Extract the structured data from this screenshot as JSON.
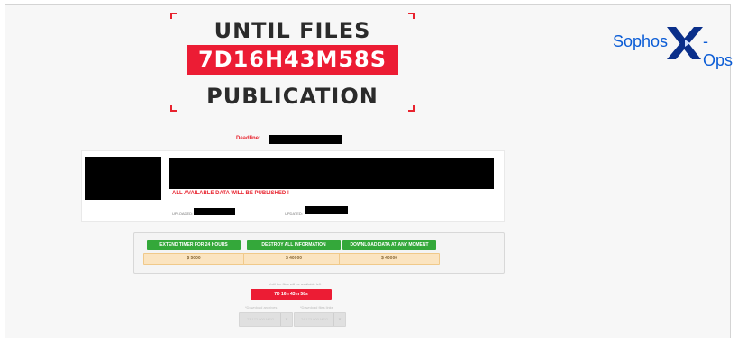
{
  "header": {
    "title_top": "UNTIL FILES",
    "countdown": "7D16H43M58S",
    "title_bottom": "PUBLICATION"
  },
  "brand": {
    "left": "Sophos",
    "right": "-Ops",
    "mark": "X",
    "color": "#0a5cd6"
  },
  "deadline": {
    "label": "Deadline:"
  },
  "card": {
    "warning": "ALL AVAILABLE DATA WILL BE PUBLISHED !",
    "uploaded_label": "UPLOADED:",
    "updated_label": "UPDATED:"
  },
  "actions": [
    {
      "label": "EXTEND TIMER FOR 24 HOURS",
      "price": "$ 5000"
    },
    {
      "label": "DESTROY ALL INFORMATION",
      "price": "$ 40000"
    },
    {
      "label": "DOWNLOAD DATA AT ANY MOMENT",
      "price": "$ 40000"
    }
  ],
  "footer": {
    "available_text": "Until the files will be available left",
    "mini_timer": "7D  16h  43m  58s",
    "countdown_label_1": "*Download archives",
    "countdown_label_2": "*Download files links",
    "button_1": "73.172.000 MEG",
    "button_2": "74.173.000 MEG",
    "dropdown_icon": "chevron-down-icon"
  },
  "colors": {
    "accent_red": "#ec1c34",
    "action_green": "#34a83a",
    "price_bg": "#fbe4c0"
  }
}
